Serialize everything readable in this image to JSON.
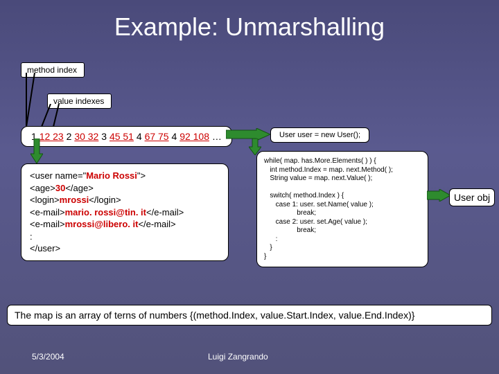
{
  "title": "Example: Unmarshalling",
  "tags": {
    "method_index": "method index",
    "value_indexes": "value indexes"
  },
  "numbers": [
    {
      "t": "1",
      "c": "black"
    },
    {
      "t": " ",
      "c": "black"
    },
    {
      "t": "12 23",
      "c": "red"
    },
    {
      "t": " ",
      "c": "black"
    },
    {
      "t": "2",
      "c": "black"
    },
    {
      "t": " ",
      "c": "black"
    },
    {
      "t": "30 32",
      "c": "red"
    },
    {
      "t": " ",
      "c": "black"
    },
    {
      "t": "3",
      "c": "black"
    },
    {
      "t": " ",
      "c": "black"
    },
    {
      "t": "45 51",
      "c": "red"
    },
    {
      "t": " ",
      "c": "black"
    },
    {
      "t": "4",
      "c": "black"
    },
    {
      "t": " ",
      "c": "black"
    },
    {
      "t": "67 75",
      "c": "red"
    },
    {
      "t": " ",
      "c": "black"
    },
    {
      "t": "4",
      "c": "black"
    },
    {
      "t": " ",
      "c": "black"
    },
    {
      "t": "92 108",
      "c": "red"
    },
    {
      "t": " ",
      "c": "black"
    },
    {
      "t": "…",
      "c": "black"
    }
  ],
  "xml_lines": [
    [
      {
        "t": "<user name=\"",
        "c": "black"
      },
      {
        "t": "Mario Rossi",
        "c": "red"
      },
      {
        "t": "\">",
        "c": "black"
      }
    ],
    [
      {
        "t": "   <age>",
        "c": "black"
      },
      {
        "t": "30",
        "c": "red"
      },
      {
        "t": "</age>",
        "c": "black"
      }
    ],
    [
      {
        "t": "   <login>",
        "c": "black"
      },
      {
        "t": "mrossi",
        "c": "red"
      },
      {
        "t": "</login>",
        "c": "black"
      }
    ],
    [
      {
        "t": "   <e-mail>",
        "c": "black"
      },
      {
        "t": "mario. rossi@tin. it",
        "c": "red"
      },
      {
        "t": "</e-mail>",
        "c": "black"
      }
    ],
    [
      {
        "t": "   <e-mail>",
        "c": "black"
      },
      {
        "t": "mrossi@libero. it",
        "c": "red"
      },
      {
        "t": "</e-mail>",
        "c": "black"
      }
    ],
    [
      {
        "t": "   :",
        "c": "black"
      }
    ],
    [
      {
        "t": "</user>",
        "c": "black"
      }
    ]
  ],
  "usernew": "User user = new User();",
  "code": "while( map. has.More.Elements( ) ) {\n   int method.Index = map. next.Method( );\n   String value = map. next.Value( );\n\n   switch( method.Index ) {\n      case 1: user. set.Name( value );\n                 break;\n      case 2: user. set.Age( value );\n                 break;\n      :\n   }\n}",
  "userobj": "User obj",
  "footnote": "The map is an array of terns of numbers {(method.Index, value.Start.Index, value.End.Index)}",
  "date": "5/3/2004",
  "author": "Luigi Zangrando"
}
